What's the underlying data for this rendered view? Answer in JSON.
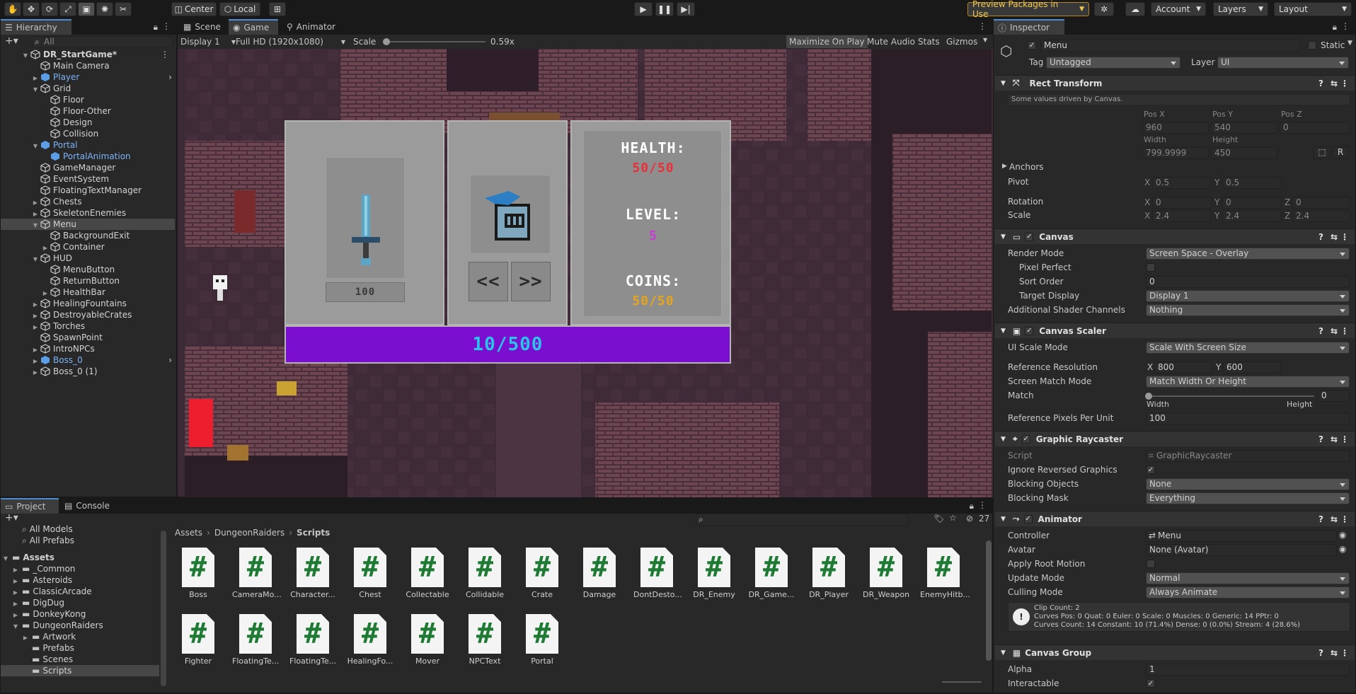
{
  "toolbar": {
    "center": "Center",
    "local": "Local",
    "preview_packages": "Preview Packages in Use",
    "account": "Account",
    "layers": "Layers",
    "layout": "Layout"
  },
  "hierarchy": {
    "tab": "Hierarchy",
    "search_placeholder": "All",
    "items": [
      {
        "label": "DR_StartGame*",
        "depth": 0,
        "arrow": "down",
        "bold": true
      },
      {
        "label": "Main Camera",
        "depth": 1,
        "arrow": ""
      },
      {
        "label": "Player",
        "depth": 1,
        "arrow": "right",
        "prefab": true
      },
      {
        "label": "Grid",
        "depth": 1,
        "arrow": "down"
      },
      {
        "label": "Floor",
        "depth": 2,
        "arrow": ""
      },
      {
        "label": "Floor-Other",
        "depth": 2,
        "arrow": ""
      },
      {
        "label": "Design",
        "depth": 2,
        "arrow": ""
      },
      {
        "label": "Collision",
        "depth": 2,
        "arrow": ""
      },
      {
        "label": "Portal",
        "depth": 1,
        "arrow": "down",
        "prefab": true
      },
      {
        "label": "PortalAnimation",
        "depth": 2,
        "arrow": "",
        "prefab": true
      },
      {
        "label": "GameManager",
        "depth": 1,
        "arrow": ""
      },
      {
        "label": "EventSystem",
        "depth": 1,
        "arrow": ""
      },
      {
        "label": "FloatingTextManager",
        "depth": 1,
        "arrow": ""
      },
      {
        "label": "Chests",
        "depth": 1,
        "arrow": "right"
      },
      {
        "label": "SkeletonEnemies",
        "depth": 1,
        "arrow": "right"
      },
      {
        "label": "Menu",
        "depth": 1,
        "arrow": "down",
        "selected": true
      },
      {
        "label": "BackgroundExit",
        "depth": 2,
        "arrow": ""
      },
      {
        "label": "Container",
        "depth": 2,
        "arrow": "right"
      },
      {
        "label": "HUD",
        "depth": 1,
        "arrow": "down"
      },
      {
        "label": "MenuButton",
        "depth": 2,
        "arrow": ""
      },
      {
        "label": "ReturnButton",
        "depth": 2,
        "arrow": ""
      },
      {
        "label": "HealthBar",
        "depth": 2,
        "arrow": "right"
      },
      {
        "label": "HealingFountains",
        "depth": 1,
        "arrow": "right"
      },
      {
        "label": "DestroyableCrates",
        "depth": 1,
        "arrow": "right"
      },
      {
        "label": "Torches",
        "depth": 1,
        "arrow": "right"
      },
      {
        "label": "SpawnPoint",
        "depth": 1,
        "arrow": ""
      },
      {
        "label": "IntroNPCs",
        "depth": 1,
        "arrow": "right"
      },
      {
        "label": "Boss_0",
        "depth": 1,
        "arrow": "right",
        "prefab": true
      },
      {
        "label": "Boss_0 (1)",
        "depth": 1,
        "arrow": "right"
      }
    ]
  },
  "game_view": {
    "tabs": [
      "Scene",
      "Game",
      "Animator"
    ],
    "display": "Display 1",
    "resolution": "Full HD (1920x1080)",
    "scale_label": "Scale",
    "scale_value": "0.59x",
    "scale_fraction": 0.0,
    "maximize": "Maximize On Play",
    "mute": "Mute Audio",
    "stats": "Stats",
    "gizmos": "Gizmos",
    "menu": {
      "weapon_price": "100",
      "health_label": "HEALTH:",
      "health_value": "50/50",
      "level_label": "LEVEL:",
      "level_value": "5",
      "coins_label": "COINS:",
      "coins_value": "50/50",
      "xp_value": "10/500",
      "prev": "<<",
      "next": ">>"
    }
  },
  "project": {
    "tabs": [
      "Project",
      "Console"
    ],
    "count": "27",
    "tree": [
      {
        "label": "All Models",
        "depth": 1
      },
      {
        "label": "All Prefabs",
        "depth": 1
      },
      {
        "label": "Assets",
        "depth": 0,
        "arrow": "down",
        "bold": true
      },
      {
        "label": "_Common",
        "depth": 1,
        "arrow": "right"
      },
      {
        "label": "Asteroids",
        "depth": 1,
        "arrow": "right"
      },
      {
        "label": "ClassicArcade",
        "depth": 1,
        "arrow": "right"
      },
      {
        "label": "DigDug",
        "depth": 1,
        "arrow": "right"
      },
      {
        "label": "DonkeyKong",
        "depth": 1,
        "arrow": "right"
      },
      {
        "label": "DungeonRaiders",
        "depth": 1,
        "arrow": "down"
      },
      {
        "label": "Artwork",
        "depth": 2,
        "arrow": "right"
      },
      {
        "label": "Prefabs",
        "depth": 2,
        "arrow": ""
      },
      {
        "label": "Scenes",
        "depth": 2,
        "arrow": ""
      },
      {
        "label": "Scripts",
        "depth": 2,
        "arrow": "",
        "selected": true
      }
    ],
    "breadcrumb": [
      "Assets",
      "DungeonRaiders",
      "Scripts"
    ],
    "files": [
      "Boss",
      "CameraMo...",
      "Character...",
      "Chest",
      "Collectable",
      "Collidable",
      "Crate",
      "Damage",
      "DontDesto...",
      "DR_Enemy",
      "DR_Game...",
      "DR_Player",
      "DR_Weapon",
      "EnemyHitb...",
      "Fighter",
      "FloatingTe...",
      "FloatingTe...",
      "HealingFo...",
      "Mover",
      "NPCText",
      "Portal"
    ],
    "file_glyph": "#"
  },
  "inspector": {
    "tab": "Inspector",
    "object_name": "Menu",
    "static": "Static",
    "tag_label": "Tag",
    "tag": "Untagged",
    "layer_label": "Layer",
    "layer": "UI",
    "rect_transform": {
      "title": "Rect Transform",
      "note": "Some values driven by Canvas.",
      "posx_label": "Pos X",
      "posy_label": "Pos Y",
      "posz_label": "Pos Z",
      "posx": "960",
      "posy": "540",
      "posz": "0",
      "width_label": "Width",
      "height_label": "Height",
      "width": "799.9999",
      "height": "450",
      "anchors": "Anchors",
      "pivot": "Pivot",
      "pivot_x": "0.5",
      "pivot_y": "0.5",
      "rotation": "Rotation",
      "rot_x": "0",
      "rot_y": "0",
      "rot_z": "0",
      "scale": "Scale",
      "scale_x": "2.4",
      "scale_y": "2.4",
      "scale_z": "2.4",
      "x": "X",
      "y": "Y",
      "z": "Z",
      "r": "R"
    },
    "canvas": {
      "title": "Canvas",
      "render_mode_label": "Render Mode",
      "render_mode": "Screen Space - Overlay",
      "pixel_perfect": "Pixel Perfect",
      "sort_order_label": "Sort Order",
      "sort_order": "0",
      "target_display_label": "Target Display",
      "target_display": "Display 1",
      "shader_channels_label": "Additional Shader Channels",
      "shader_channels": "Nothing"
    },
    "canvas_scaler": {
      "title": "Canvas Scaler",
      "ui_scale_mode_label": "UI Scale Mode",
      "ui_scale_mode": "Scale With Screen Size",
      "ref_res_label": "Reference Resolution",
      "ref_x": "800",
      "ref_y": "600",
      "match_mode_label": "Screen Match Mode",
      "match_mode": "Match Width Or Height",
      "match_label": "Match",
      "match_value": "0",
      "width": "Width",
      "height": "Height",
      "ppu_label": "Reference Pixels Per Unit",
      "ppu": "100"
    },
    "graphic_raycaster": {
      "title": "Graphic Raycaster",
      "script_label": "Script",
      "script": "GraphicRaycaster",
      "ignore_label": "Ignore Reversed Graphics",
      "blocking_objects_label": "Blocking Objects",
      "blocking_objects": "None",
      "blocking_mask_label": "Blocking Mask",
      "blocking_mask": "Everything"
    },
    "animator": {
      "title": "Animator",
      "controller_label": "Controller",
      "controller": "Menu",
      "avatar_label": "Avatar",
      "avatar": "None (Avatar)",
      "root_motion_label": "Apply Root Motion",
      "update_mode_label": "Update Mode",
      "update_mode": "Normal",
      "culling_label": "Culling Mode",
      "culling": "Always Animate",
      "info1": "Clip Count: 2",
      "info2": "Curves Pos: 0 Quat: 0 Euler: 0 Scale: 0 Muscles: 0 Generic: 14 PPtr: 0",
      "info3": "Curves Count: 14 Constant: 10 (71.4%) Dense: 0 (0.0%) Stream: 4 (28.6%)"
    },
    "canvas_group": {
      "title": "Canvas Group",
      "alpha_label": "Alpha",
      "alpha": "1",
      "interactable_label": "Interactable"
    }
  },
  "colors": {
    "accent": "#4d8dd6",
    "health": "#e8313a",
    "level": "#c93ad6",
    "coins": "#e6a51e",
    "xp_bar": "#7a0fd0",
    "xp_text": "#2fc2e8"
  }
}
